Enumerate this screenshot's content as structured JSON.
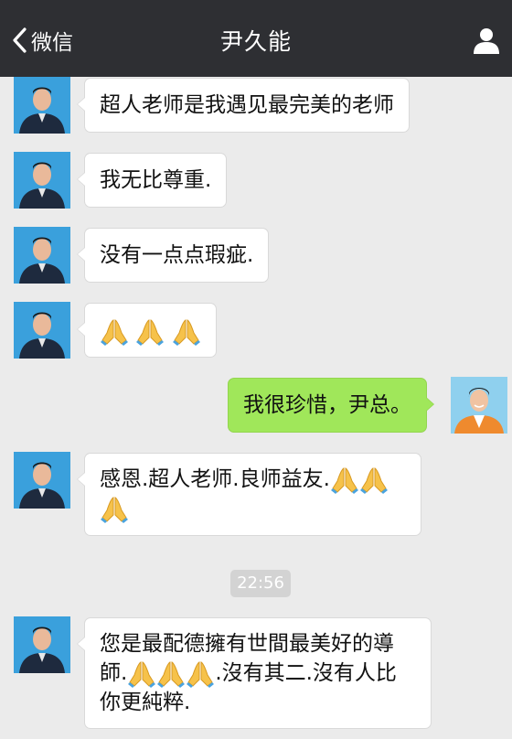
{
  "header": {
    "back_label": "微信",
    "title": "尹久能",
    "back_icon": "chevron-left-icon",
    "profile_icon": "person-icon"
  },
  "colors": {
    "nav_background": "#2e2f33",
    "chat_background": "#ebebeb",
    "incoming_bubble": "#ffffff",
    "outgoing_bubble": "#a0e75a"
  },
  "messages": [
    {
      "side": "left",
      "text": "超人老师是我遇见最完美的老师"
    },
    {
      "side": "left",
      "text": "我无比尊重."
    },
    {
      "side": "left",
      "text": "没有一点点瑕疵."
    },
    {
      "side": "left",
      "emoji": [
        "folded-hands-emoji",
        "folded-hands-emoji",
        "folded-hands-emoji"
      ]
    },
    {
      "side": "right",
      "text": "我很珍惜，尹总。"
    },
    {
      "side": "left",
      "text": "感恩.超人老师.良师益友."
    },
    {
      "side": "left",
      "line1": "您是最配德擁有世間最美好的導",
      "line2_start": "師.",
      "line2_end": ".沒有其二.沒有人比",
      "line3": "你更純粹."
    }
  ],
  "timestamp": "22:56"
}
